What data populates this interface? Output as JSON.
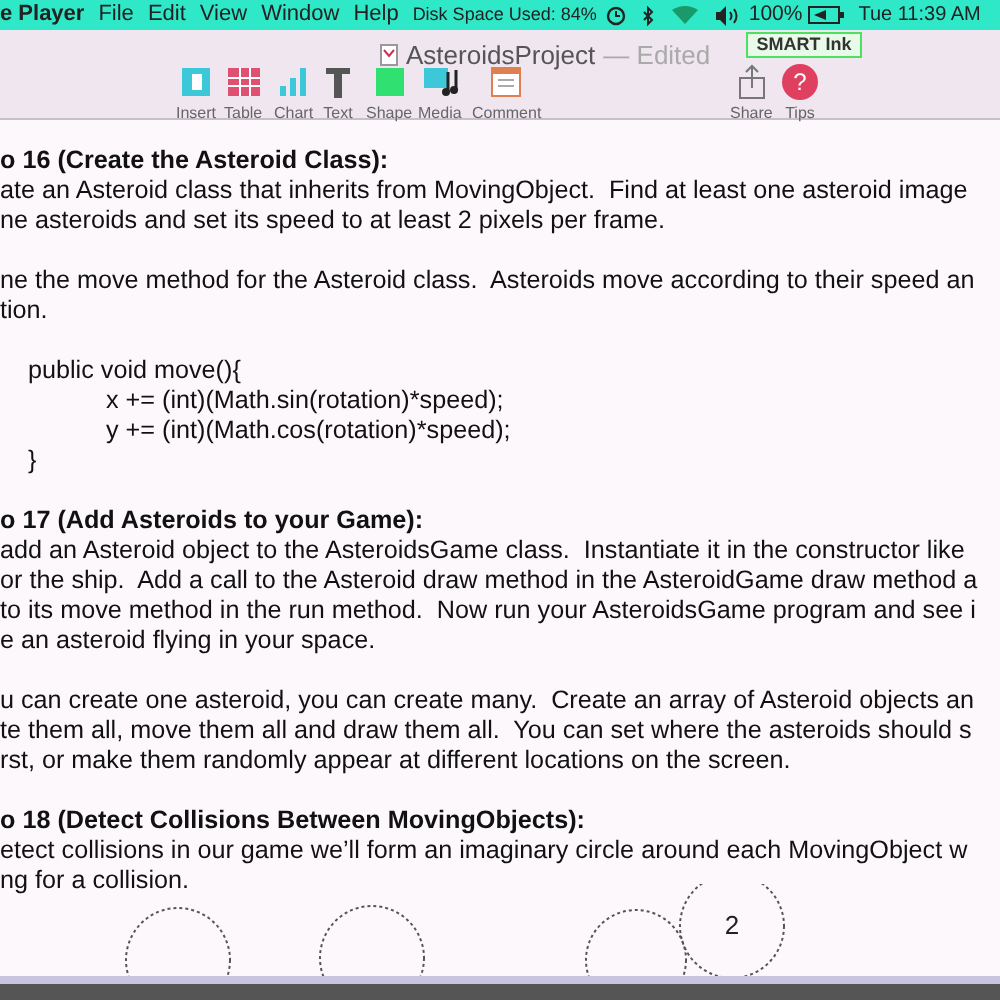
{
  "menubar": {
    "app_name": "e Player",
    "menus": [
      "File",
      "Edit",
      "View",
      "Window",
      "Help"
    ],
    "disk": "Disk Space Used: 84%",
    "battery": "100%",
    "clock": "Tue 11:39 AM"
  },
  "smart_ink": {
    "label": "SMART Ink"
  },
  "window": {
    "title": "AsteroidsProject",
    "status": "— Edited"
  },
  "toolbar": [
    {
      "kind": "insert",
      "label": "Insert"
    },
    {
      "kind": "table",
      "label": "Table"
    },
    {
      "kind": "chart",
      "label": "Chart"
    },
    {
      "kind": "text",
      "label": "Text"
    },
    {
      "kind": "shape",
      "label": "Shape"
    },
    {
      "kind": "media",
      "label": "Media"
    },
    {
      "kind": "comment",
      "label": "Comment"
    }
  ],
  "toolbar_right": [
    {
      "kind": "share",
      "label": "Share"
    },
    {
      "kind": "tips",
      "label": "Tips",
      "glyph": "?"
    }
  ],
  "document": [
    {
      "kind": "heading",
      "text": "o 16 (Create the Asteroid Class):"
    },
    {
      "kind": "body",
      "text": "ate an Asteroid class that inherits from MovingObject.  Find at least one asteroid image"
    },
    {
      "kind": "body",
      "text": "ne asteroids and set its speed to at least 2 pixels per frame."
    },
    {
      "kind": "blank"
    },
    {
      "kind": "body",
      "text": "ne the move method for the Asteroid class.  Asteroids move according to their speed an"
    },
    {
      "kind": "body",
      "text": "tion."
    },
    {
      "kind": "blank"
    },
    {
      "kind": "code",
      "text": "public void move(){"
    },
    {
      "kind": "code_inner",
      "text": "x += (int)(Math.sin(rotation)*speed);"
    },
    {
      "kind": "code_inner",
      "text": "y += (int)(Math.cos(rotation)*speed);"
    },
    {
      "kind": "code",
      "text": "}"
    },
    {
      "kind": "blank"
    },
    {
      "kind": "heading",
      "text": "o 17 (Add Asteroids to your Game):"
    },
    {
      "kind": "body",
      "text": "add an Asteroid object to the AsteroidsGame class.  Instantiate it in the constructor like"
    },
    {
      "kind": "body",
      "text": "or the ship.  Add a call to the Asteroid draw method in the AsteroidGame draw method a"
    },
    {
      "kind": "body",
      "text": "to its move method in the run method.  Now run your AsteroidsGame program and see i"
    },
    {
      "kind": "body",
      "text": "e an asteroid flying in your space."
    },
    {
      "kind": "blank"
    },
    {
      "kind": "body",
      "text": "u can create one asteroid, you can create many.  Create an array of Asteroid objects an"
    },
    {
      "kind": "body",
      "text": "te them all, move them all and draw them all.  You can set where the asteroids should s"
    },
    {
      "kind": "body",
      "text": "rst, or make them randomly appear at different locations on the screen."
    },
    {
      "kind": "blank"
    },
    {
      "kind": "heading",
      "text": "o 18 (Detect Collisions Between MovingObjects):"
    },
    {
      "kind": "body",
      "text": "etect collisions in our game we’ll form an imaginary circle around each MovingObject w"
    },
    {
      "kind": "body",
      "text": "ng for a collision."
    }
  ],
  "circle_label": "2"
}
